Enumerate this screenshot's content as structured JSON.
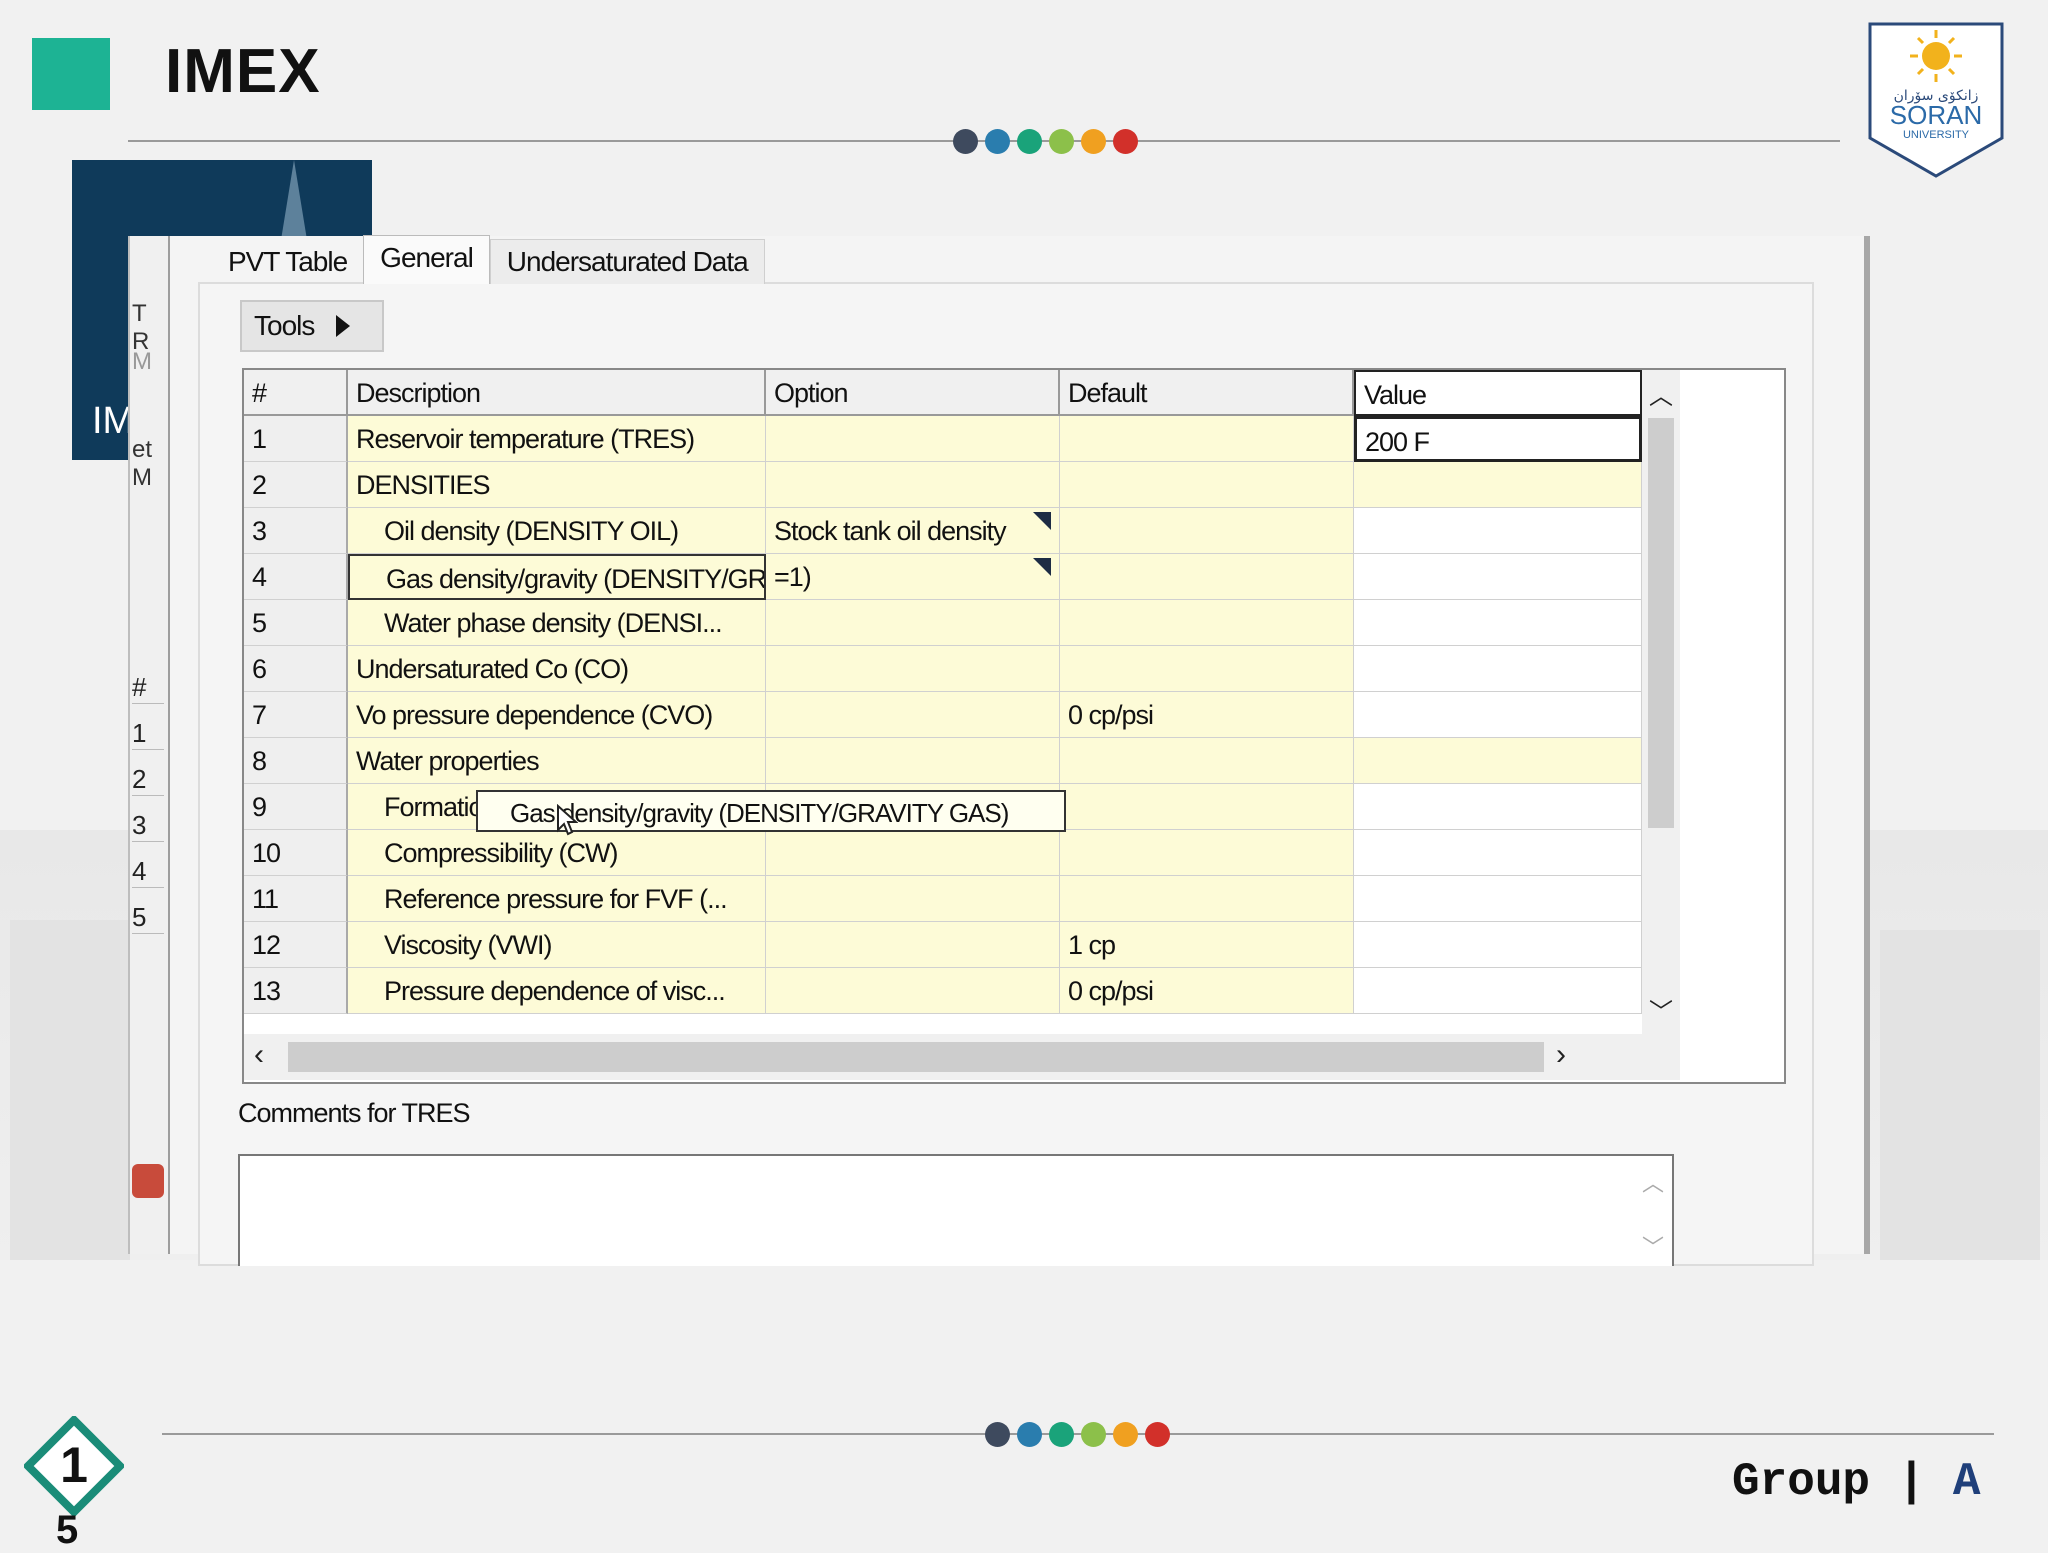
{
  "slide": {
    "title": "IMEX",
    "page_number": "1",
    "page_number_cont": "5",
    "footer_group": "Group",
    "footer_sep": "|",
    "footer_letter": "A",
    "dot_colors": [
      "#3e4a5e",
      "#2a7dae",
      "#1aa37a",
      "#8cc04a",
      "#f0a020",
      "#d2302a"
    ],
    "accent": "#1db394"
  },
  "logo": {
    "arabic_text": "زانكۆی سۆران",
    "name": "SORAN",
    "subtitle": "UNIVERSITY"
  },
  "background_window": {
    "fragment_text": "IM",
    "strip_fragments": [
      "T R",
      "M",
      "et M"
    ],
    "strip_rows": [
      "#",
      "1",
      "2",
      "3",
      "4",
      "5"
    ]
  },
  "tabs": [
    {
      "label": "PVT Table",
      "active": false
    },
    {
      "label": "General",
      "active": true
    },
    {
      "label": "Undersaturated Data",
      "active": false
    }
  ],
  "tools_button": {
    "label": "Tools"
  },
  "grid": {
    "columns": [
      "#",
      "Description",
      "Option",
      "Default",
      "Value"
    ],
    "rows": [
      {
        "num": "1",
        "description": "Reservoir temperature (TRES)",
        "option": "",
        "default": "",
        "value": "200 F"
      },
      {
        "num": "2",
        "description": "DENSITIES",
        "option": "",
        "default": "",
        "value": ""
      },
      {
        "num": "3",
        "description": "Oil density (DENSITY OIL)",
        "option": "Stock tank oil density",
        "default": "",
        "value": ""
      },
      {
        "num": "4",
        "description": "Gas density/gravity (DENSITY/GRAVITY GAS)",
        "option": "=1)",
        "default": "",
        "value": ""
      },
      {
        "num": "5",
        "description": "Water phase density (DENSI...",
        "option": "",
        "default": "",
        "value": ""
      },
      {
        "num": "6",
        "description": "Undersaturated Co (CO)",
        "option": "",
        "default": "",
        "value": ""
      },
      {
        "num": "7",
        "description": "Vo pressure dependence (CVO)",
        "option": "",
        "default": "0 cp/psi",
        "value": ""
      },
      {
        "num": "8",
        "description": "Water properties",
        "option": "",
        "default": "",
        "value": ""
      },
      {
        "num": "9",
        "description": "Formation Volume Factor (BWI)",
        "option": "",
        "default": "",
        "value": ""
      },
      {
        "num": "10",
        "description": "Compressibility (CW)",
        "option": "",
        "default": "",
        "value": ""
      },
      {
        "num": "11",
        "description": "Reference pressure for FVF (...",
        "option": "",
        "default": "",
        "value": ""
      },
      {
        "num": "12",
        "description": "Viscosity (VWI)",
        "option": "",
        "default": "1 cp",
        "value": ""
      },
      {
        "num": "13",
        "description": "Pressure dependence of visc...",
        "option": "",
        "default": "0 cp/psi",
        "value": ""
      }
    ],
    "tooltip": "Gas density/gravity (DENSITY/GRAVITY GAS)"
  },
  "comments": {
    "label": "Comments for TRES",
    "value": ""
  }
}
